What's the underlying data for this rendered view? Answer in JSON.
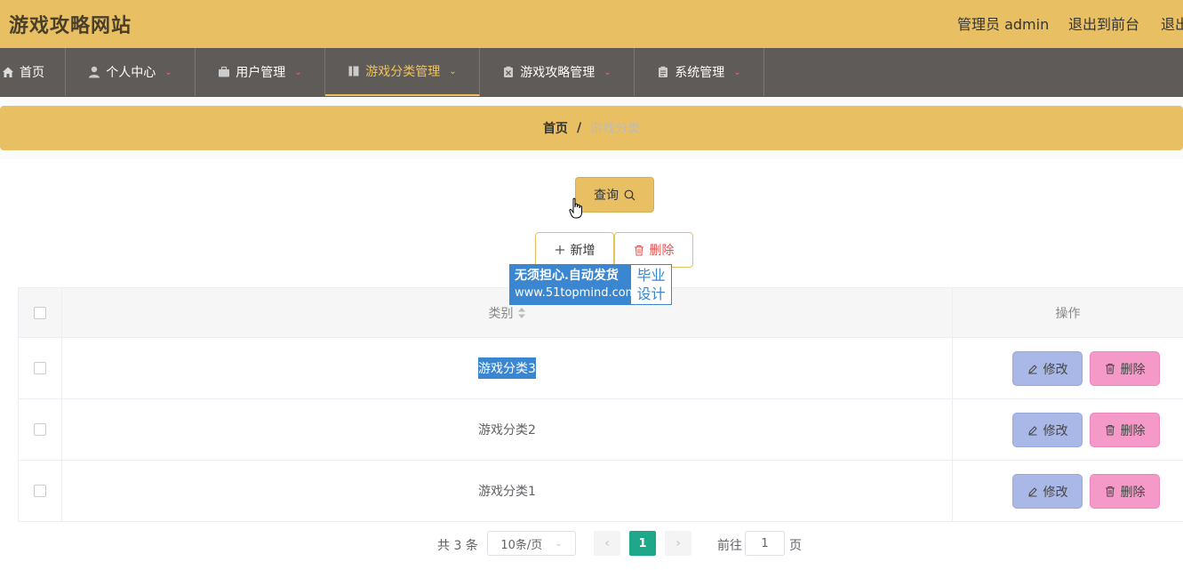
{
  "header": {
    "site_title": "游戏攻略网站",
    "admin_label": "管理员 admin",
    "back_to_front": "退出到前台",
    "logout": "退出"
  },
  "nav": {
    "items": [
      {
        "label": "首页",
        "icon": "home-icon"
      },
      {
        "label": "个人中心",
        "icon": "user-icon"
      },
      {
        "label": "用户管理",
        "icon": "briefcase-icon"
      },
      {
        "label": "游戏分类管理",
        "icon": "book-icon",
        "active": true
      },
      {
        "label": "游戏攻略管理",
        "icon": "clipboard-x-icon"
      },
      {
        "label": "系统管理",
        "icon": "clipboard-icon"
      }
    ]
  },
  "breadcrumb": {
    "home": "首页",
    "separator": "/",
    "current": "游戏分类"
  },
  "toolbar": {
    "query_label": "查询",
    "add_label": "新增",
    "delete_label": "删除"
  },
  "watermark": {
    "line1": "无须担心.自动发货",
    "line2": "www.51topmind.com",
    "right_line1": "毕业",
    "right_line2": "设计"
  },
  "table": {
    "headers": {
      "category": "类别",
      "operation": "操作"
    },
    "rows": [
      {
        "category": "游戏分类3",
        "selected_text": true
      },
      {
        "category": "游戏分类2"
      },
      {
        "category": "游戏分类1"
      }
    ],
    "edit_label": "修改",
    "delete_label": "删除"
  },
  "pagination": {
    "total_text": "共 3 条",
    "page_size": "10条/页",
    "current_page": "1",
    "goto_label": "前往",
    "goto_value": "1",
    "page_suffix": "页"
  },
  "colors": {
    "header_bg": "#e8c063",
    "nav_bg": "#5f5b58",
    "nav_active": "#f0c35a",
    "edit_btn": "#a9b8e6",
    "delete_btn": "#f59ac8",
    "page_active": "#1ea88a"
  }
}
